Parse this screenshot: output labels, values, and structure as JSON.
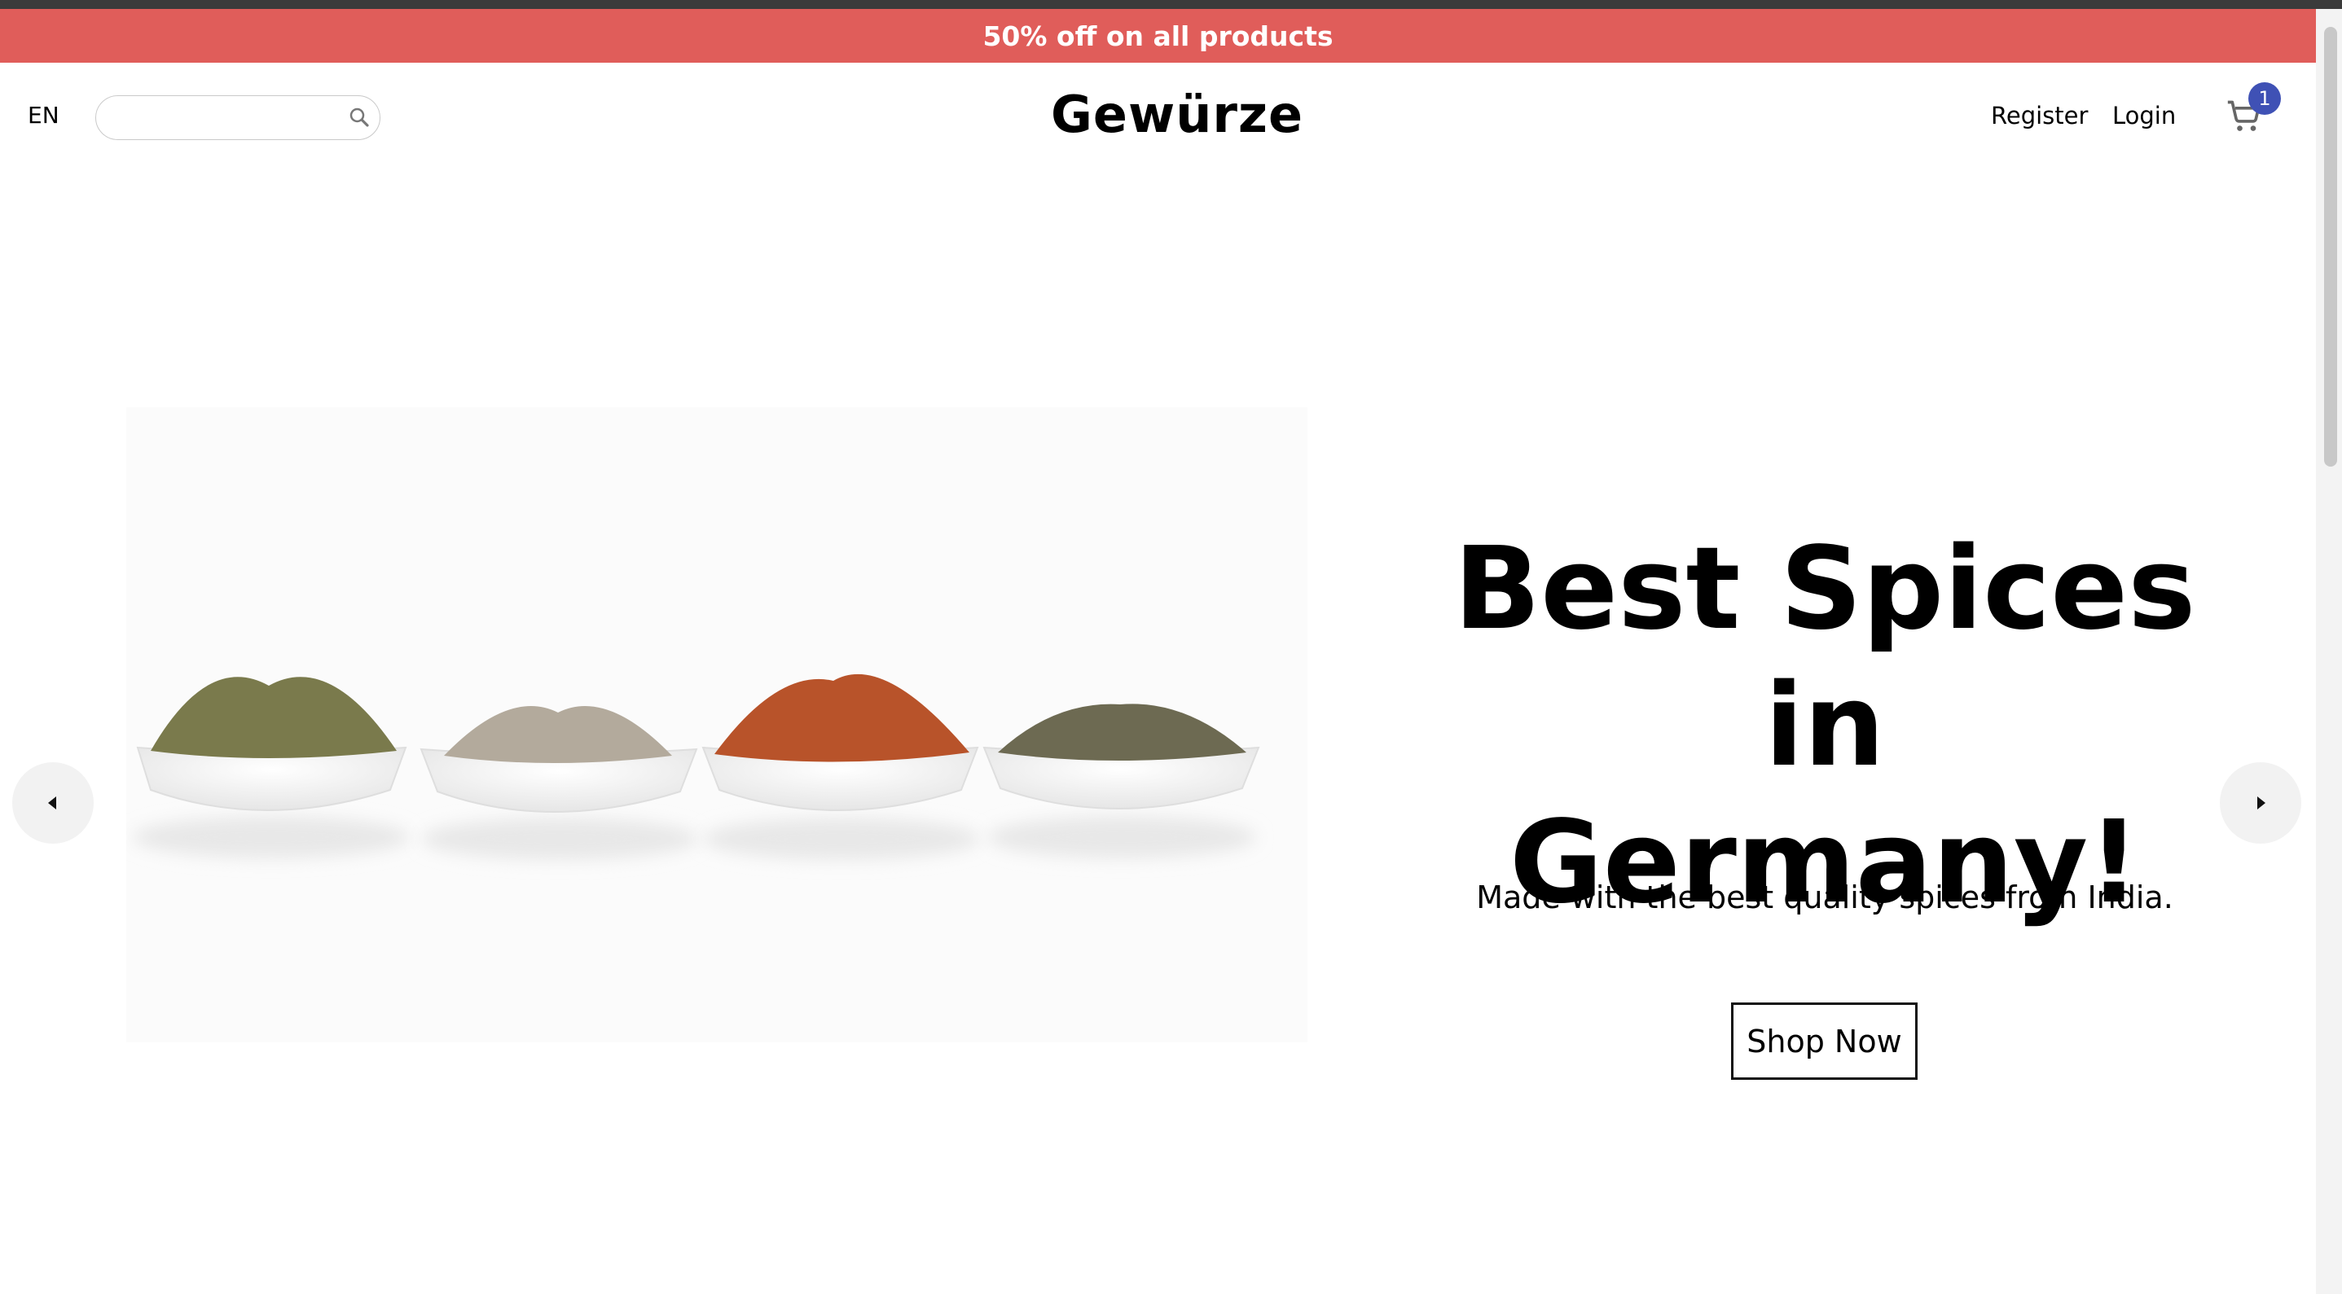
{
  "promo": {
    "text": "50% off on all products",
    "color": "#e05d5a"
  },
  "header": {
    "language": "EN",
    "search": {
      "placeholder": "",
      "value": "",
      "icon": "search-icon"
    },
    "brand": "Gewürze",
    "nav": {
      "register": "Register",
      "login": "Login"
    },
    "cart": {
      "icon": "cart-icon",
      "count": "1",
      "badge_color": "#3f51b5"
    }
  },
  "hero": {
    "title_line1": "Best Spices in",
    "title_line2": "Germany!",
    "subtitle": "Made with the best quality spices from India.",
    "cta": "Shop Now",
    "image": "spice-bowls-image",
    "prev_icon": "caret-left-icon",
    "next_icon": "caret-right-icon"
  }
}
